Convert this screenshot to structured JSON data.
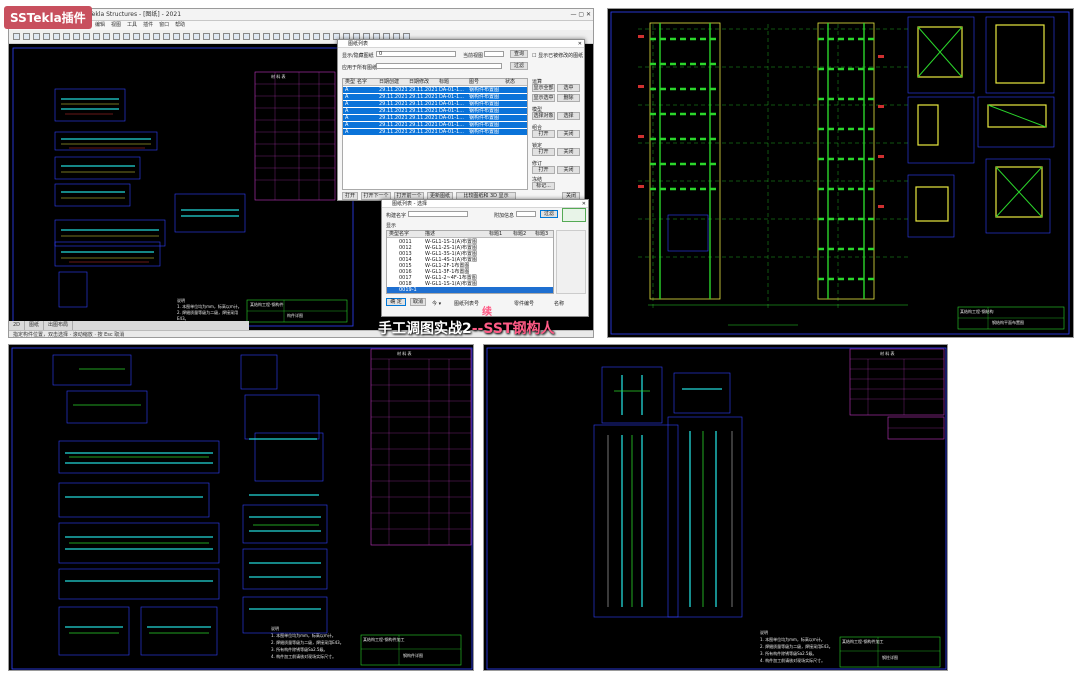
{
  "badge": "SSTekla插件",
  "app": {
    "title": "Tekla Structures  - [图纸]  - 2021",
    "menu": [
      "文件",
      "编辑",
      "视图",
      "工具",
      "插件",
      "窗口",
      "帮助"
    ],
    "tabs": [
      "2D",
      "图纸",
      "出图布局"
    ],
    "status": "指定构件位置，双击选择 · 滚动缩放 · 按 Esc 取消"
  },
  "dialog1": {
    "title": "图纸列表",
    "search_label": "显示/隐藏图纸",
    "search_value": "0",
    "filter_label": "当前视图",
    "filter_btn": "查询",
    "checkbox_label": "显示已被修改的图纸",
    "second_label": "应用于所有图纸",
    "second_btn": "过滤",
    "columns": [
      "类型",
      "名字",
      "日期创建",
      "日期修改",
      "标题",
      "图号",
      "状态"
    ],
    "rows": [
      [
        "A",
        "",
        "29.11.2021",
        "29.11.2021",
        "DA-01-1...",
        "钢构件布置图",
        ""
      ],
      [
        "A",
        "",
        "29.11.2021",
        "29.11.2021",
        "DA-01-1...",
        "钢构件布置图",
        ""
      ],
      [
        "A",
        "",
        "29.11.2021",
        "29.11.2021",
        "DA-01-1...",
        "钢构件布置图",
        ""
      ],
      [
        "A",
        "",
        "29.11.2021",
        "29.11.2021",
        "DA-01-1...",
        "钢构件布置图",
        ""
      ],
      [
        "A",
        "",
        "29.11.2021",
        "29.11.2021",
        "DA-01-1...",
        "钢构件布置图",
        ""
      ],
      [
        "A",
        "",
        "29.11.2021",
        "29.11.2021",
        "DA-01-1...",
        "钢构件布置图",
        ""
      ],
      [
        "A",
        "",
        "29.11.2021",
        "29.11.2021",
        "DA-01-1...",
        "钢构件布置图",
        ""
      ]
    ],
    "side": {
      "sec1": "运算",
      "b1": "显示全部",
      "b2": "选中",
      "b3": "显示选中",
      "b4": "删除",
      "sec2": "模型",
      "b5": "选择对象",
      "b6": "选择",
      "sec3": "组合",
      "b7": "打开",
      "b8": "关闭",
      "sec4": "锁定",
      "b9": "打开",
      "b10": "关闭",
      "sec5": "修订",
      "b11": "打开",
      "b12": "关闭",
      "sec6": "冻结",
      "b13": "标记..."
    },
    "footer": [
      "打开",
      "打开下一个",
      "打开前一个",
      "更新图纸",
      "比较图纸和 3D 显示",
      "关闭"
    ]
  },
  "dialog2": {
    "title": "图纸列表 - 选择",
    "label1": "构建名字",
    "label2": "附加信息",
    "btn_filter": "过滤",
    "label3": "显示",
    "columns": [
      "类型",
      "名字",
      "描述",
      "标题1",
      "标题2",
      "标题3"
    ],
    "rows": [
      [
        "",
        "0011",
        "W-GL1-1S-1(A)布置图",
        "",
        "",
        ""
      ],
      [
        "",
        "0012",
        "W-GL1-2S-1(A)布置图",
        "",
        "",
        ""
      ],
      [
        "",
        "0013",
        "W-GL1-3S-1(A)布置图",
        "",
        "",
        ""
      ],
      [
        "",
        "0014",
        "W-GL1-4S-1(A)布置图",
        "",
        "",
        ""
      ],
      [
        "",
        "0015",
        "W-GL1-2F-1布置图",
        "",
        "",
        ""
      ],
      [
        "",
        "0016",
        "W-GL1-3F-1布置图",
        "",
        "",
        ""
      ],
      [
        "",
        "0017",
        "W-GL1-2~4F-1布置图",
        "",
        "",
        ""
      ],
      [
        "",
        "0018",
        "W-GL1-1S-1(A)布置图",
        "",
        "",
        ""
      ],
      [
        "",
        "0019-1",
        "",
        "",
        "",
        ""
      ]
    ],
    "bottom_left": "确 定",
    "bottom_left2": "取消",
    "bottom_mid": "今 ▾",
    "bottom_label": "图纸列表号",
    "bottom_label2": "零件编号",
    "bottom_right": "名称"
  },
  "caption": {
    "main": "手工调图实战2",
    "sep": "--",
    "brand": "SST钢构人",
    "top": "续"
  },
  "drawings": {
    "tr_title": "某结构工程-钢结构",
    "tr_sheet": "钢结构平面布置图",
    "bl_title": "某结构工程-钢构件加工",
    "bl_sheet": "钢构件详图",
    "br_title": "某结构工程-钢构件加工",
    "br_sheet": "钢柱详图",
    "tl_title": "某结构工程-钢构件",
    "tl_sheet": "构件详图",
    "notes_title": "说明",
    "notes": [
      "1. 本图单位均为mm，标高以m计。",
      "2. 焊缝质量等级为二级，焊接采用E43。",
      "3. 所有构件除锈等级Sa2.5级。",
      "4. 构件加工前请核对现场实际尺寸。"
    ],
    "mat_table_title": "材 料 表"
  },
  "colors": {
    "cad_bg": "#000000",
    "green": "#2bd62b",
    "yellow": "#e8e840",
    "cyan": "#22d8d8",
    "blue": "#2f40ff",
    "magenta": "#c038c0",
    "white": "#e8e8e8",
    "select_blue": "#1473d6",
    "badge": "#c8505e",
    "caption_pink": "#ff5b86"
  }
}
